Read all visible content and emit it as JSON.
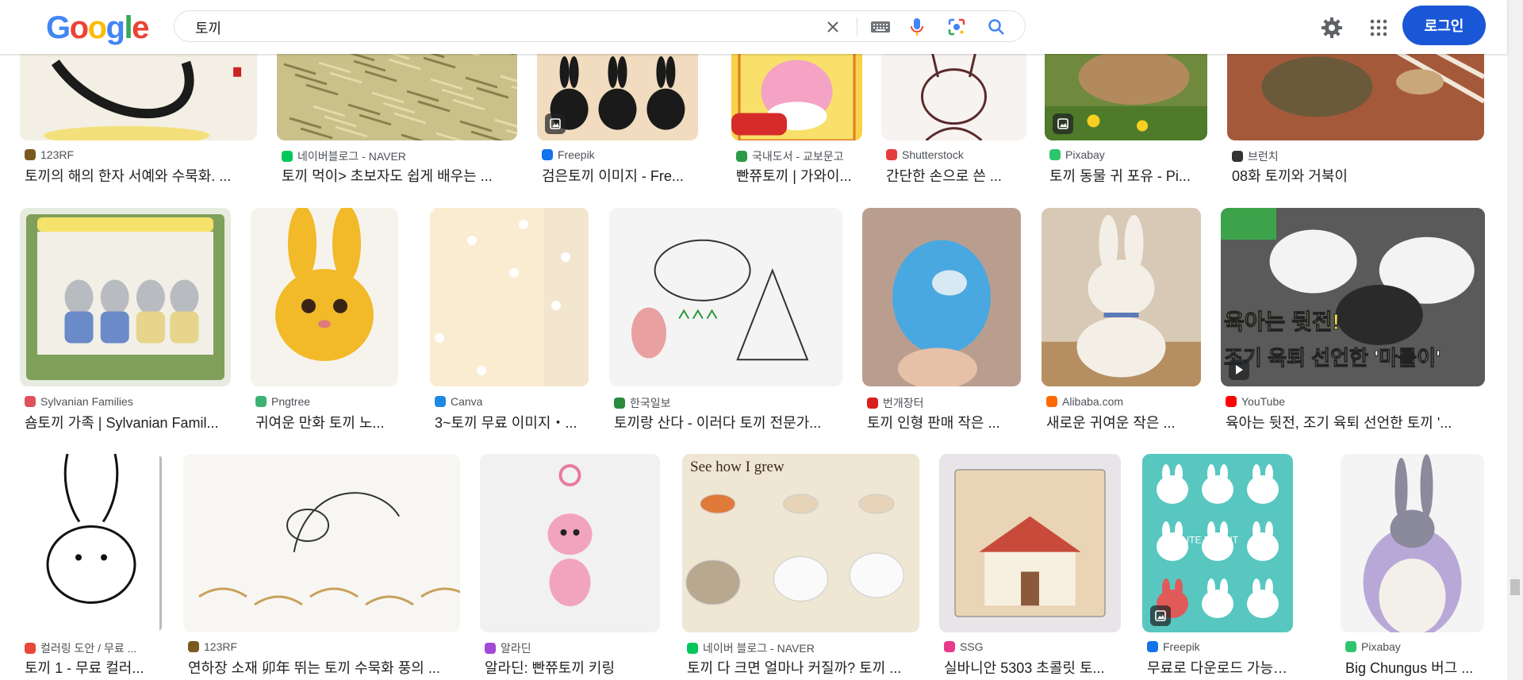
{
  "header": {
    "logo_letters": [
      {
        "ch": "G",
        "color": "#4285F4"
      },
      {
        "ch": "o",
        "color": "#EA4335"
      },
      {
        "ch": "o",
        "color": "#FBBC05"
      },
      {
        "ch": "g",
        "color": "#4285F4"
      },
      {
        "ch": "l",
        "color": "#34A853"
      },
      {
        "ch": "e",
        "color": "#EA4335"
      }
    ],
    "search_value": "토끼",
    "login_label": "로그인",
    "icons": [
      "close-icon",
      "keyboard-icon",
      "microphone-icon",
      "lens-icon",
      "search-icon",
      "gear-icon",
      "apps-icon"
    ]
  },
  "rows": [
    {
      "items": [
        {
          "source": "123RF",
          "title": "토끼의 해의 한자 서예와 수묵화. ...",
          "fav": "#7a5a1e",
          "bg": "#f3efe4",
          "fg": "#1b1b1b",
          "kind": "calligraphy"
        },
        {
          "source": "네이버블로그 - NAVER",
          "title": "토끼 먹이> 초보자도 쉽게 배우는 ...",
          "fav": "#03c75a",
          "bg": "#c9c08a",
          "fg": "#8a7f4a",
          "kind": "hay"
        },
        {
          "source": "Freepik",
          "title": "검은토끼 이미지 - Fre...",
          "fav": "#1273eb",
          "bg": "#f2dcc0",
          "fg": "#1a1a1a",
          "kind": "blackbunnies",
          "badge": true
        },
        {
          "source": "국내도서 - 교보문고",
          "title": "빤쮸토끼 | 가와이...",
          "fav": "#2e9b47",
          "bg": "#f7d34a",
          "fg": "#f4a3c4",
          "kind": "pinkbunny"
        },
        {
          "source": "Shutterstock",
          "title": "간단한 손으로 쓴 ...",
          "fav": "#e33d3d",
          "bg": "#f7f3f1",
          "fg": "#5a2a2a",
          "kind": "lineart"
        },
        {
          "source": "Pixabay",
          "title": "토끼 동물 귀 포유 - Pi...",
          "fav": "#2ec66d",
          "bg": "#6f8a3d",
          "fg": "#b38a5e",
          "kind": "realbunny",
          "badge": true
        },
        {
          "source": "브런치",
          "title": "08화 토끼와 거북이",
          "fav": "#333333",
          "bg": "#a45a3a",
          "fg": "#6b5a3a",
          "kind": "turtle"
        }
      ]
    },
    {
      "items": [
        {
          "source": "Sylvanian Families",
          "title": "숌토끼 가족 | Sylvanian Famil...",
          "fav": "#e0525a",
          "bg": "#e7ebe0",
          "fg": "#7ea05c",
          "kind": "toybox"
        },
        {
          "source": "Pngtree",
          "title": "귀여운 만화 토끼 노...",
          "fav": "#3bb273",
          "bg": "#f6f3ec",
          "fg": "#f2b928",
          "kind": "yellowbunny"
        },
        {
          "source": "Canva",
          "title": "3~토끼 무료 이미지・...",
          "fav": "#1e88e5",
          "bg": "#f8d58e",
          "fg": "#f9ecd0",
          "kind": "canva"
        },
        {
          "source": "한국일보",
          "title": "토끼랑 산다 - 이러다 토끼 전문가...",
          "fav": "#2b8a3e",
          "bg": "#f4f4f4",
          "fg": "#e8a0a0",
          "kind": "doodle"
        },
        {
          "source": "번개장터",
          "title": "토끼 인형 판매 작은 ...",
          "fav": "#d81e1e",
          "bg": "#b99e8f",
          "fg": "#4aa8e0",
          "kind": "bluedoll"
        },
        {
          "source": "Alibaba.com",
          "title": "새로운 귀여운 작은 ...",
          "fav": "#ff6a00",
          "bg": "#d8c9b6",
          "fg": "#f4efe6",
          "kind": "whiteplush"
        },
        {
          "source": "YouTube",
          "title": "육아는 뒷전, 조기 육퇴 선언한 토끼 '...",
          "fav": "#ff0000",
          "bg": "#6a6a6a",
          "fg": "#ffffff",
          "kind": "video",
          "badge": true,
          "caption": "육아는 뒷전!",
          "caption2": "조기 육퇴 선언한 '마를이'"
        }
      ]
    },
    {
      "items": [
        {
          "source": "컬러링 도안 / 무료 ...",
          "title": "토끼 1 - 무료 컬러...",
          "fav": "#e8483a",
          "bg": "#ffffff",
          "fg": "#111111",
          "kind": "coloring"
        },
        {
          "source": "123RF",
          "title": "연하장 소재 卯年 뛰는 토끼 수묵화 풍의 ...",
          "fav": "#7a5a1e",
          "bg": "#f7f6f3",
          "fg": "#c8a15a",
          "kind": "jumping"
        },
        {
          "source": "알라딘",
          "title": "알라딘: 빤쮸토끼 키링",
          "fav": "#a14ad6",
          "bg": "#f1f1f1",
          "fg": "#f2a4be",
          "kind": "keyring"
        },
        {
          "source": "네이버 블로그 - NAVER",
          "title": "토끼 다 크면 얼마나 커질까? 토끼 ...",
          "fav": "#03c75a",
          "bg": "#efe6d3",
          "fg": "#3a2a1a",
          "kind": "growth",
          "caption": "See how I grew"
        },
        {
          "source": "SSG",
          "title": "실바니안 5303 초콜릿 토...",
          "fav": "#e83a8a",
          "bg": "#e8e4e8",
          "fg": "#c84a3a",
          "kind": "house"
        },
        {
          "source": "Freepik",
          "title": "무료로 다운로드 가능한 ...",
          "fav": "#1273eb",
          "bg": "#57c7c0",
          "fg": "#ffffff",
          "kind": "cutebunnies",
          "badge": true,
          "caption": "CUTE RABBIT"
        },
        {
          "source": "Pixabay",
          "title": "Big Chungus 버그 ...",
          "fav": "#2ec66d",
          "bg": "#f4f4f4",
          "fg": "#8a8a9c",
          "kind": "chungus"
        }
      ]
    }
  ]
}
